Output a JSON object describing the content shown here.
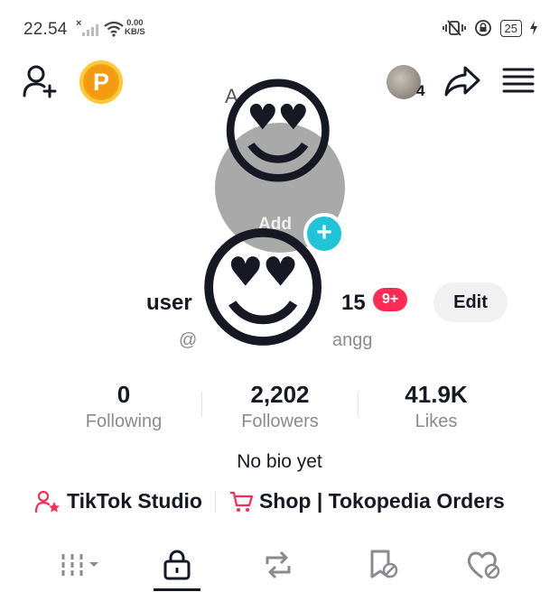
{
  "status_bar": {
    "time": "22.54",
    "speed_value": "0.00",
    "speed_unit": "KB/S",
    "battery": "25"
  },
  "header": {
    "add_friend_icon": "person-plus-icon",
    "coin_label": "P",
    "notification_count": "4",
    "share_icon": "share-arrow-icon",
    "menu_icon": "hamburger-menu-icon",
    "partial_name": "A"
  },
  "profile": {
    "add_label": "Add",
    "username_start": "user",
    "username_end": "15",
    "notification_badge": "9+",
    "edit_label": "Edit",
    "handle_start": "@",
    "handle_end": "angg"
  },
  "stats": [
    {
      "value": "0",
      "label": "Following"
    },
    {
      "value": "2,202",
      "label": "Followers"
    },
    {
      "value": "41.9K",
      "label": "Likes"
    }
  ],
  "bio": "No bio yet",
  "links": {
    "studio_label": "TikTok Studio",
    "shop_label": "Shop | Tokopedia Orders"
  },
  "tabs": [
    "videos-grid-icon",
    "lock-icon",
    "repost-icon",
    "favorites-icon",
    "liked-icon"
  ],
  "colors": {
    "accent_pink": "#fe2c55",
    "accent_cyan": "#20c3d8",
    "coin_gold": "#f2a011"
  }
}
